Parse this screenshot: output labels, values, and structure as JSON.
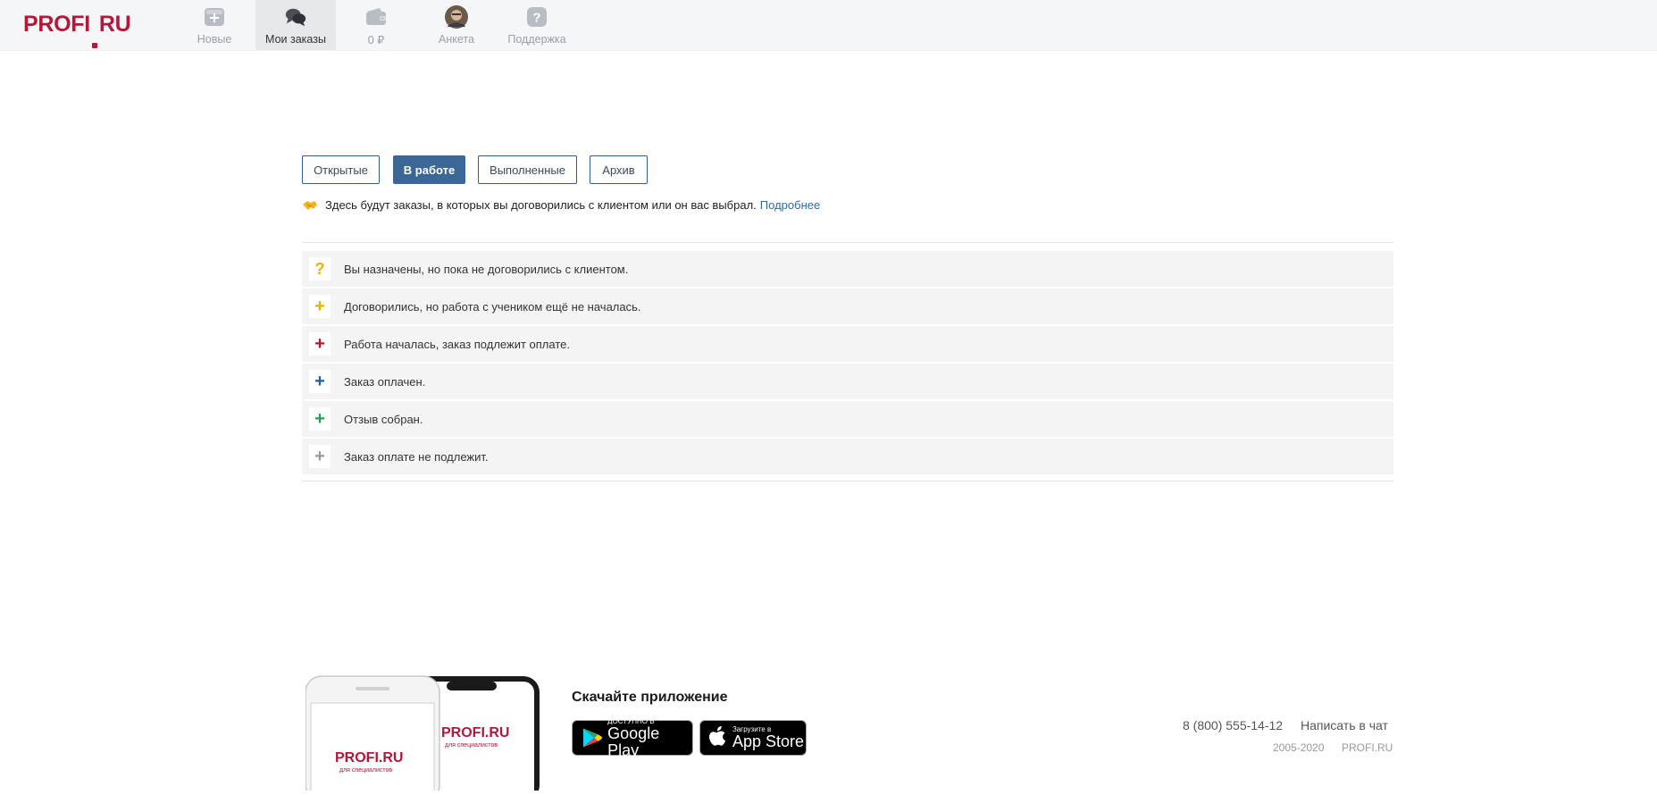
{
  "header": {
    "logo": "PROFI.RU",
    "nav": [
      {
        "label": "Новые",
        "icon": "new-orders-icon"
      },
      {
        "label": "Мои заказы",
        "icon": "chat-bubbles-icon",
        "active": true
      },
      {
        "label": "0 ₽",
        "icon": "wallet-icon"
      },
      {
        "label": "Анкета",
        "icon": "avatar"
      },
      {
        "label": "Поддержка",
        "icon": "question-icon"
      }
    ]
  },
  "tabs": [
    {
      "label": "Открытые"
    },
    {
      "label": "В работе",
      "selected": true
    },
    {
      "label": "Выполненные"
    },
    {
      "label": "Архив"
    }
  ],
  "info": {
    "icon": "handshake-icon",
    "text": "Здесь будут заказы, в которых вы договорились с клиентом или он вас выбрал.",
    "link": "Подробнее"
  },
  "legend": [
    {
      "symbol": "?",
      "color": "#e7b400",
      "text": "Вы назначены, но пока не договорились с клиентом."
    },
    {
      "symbol": "+",
      "color": "#e7b400",
      "text": "Договорились, но работа с учеником ещё не началась."
    },
    {
      "symbol": "+",
      "color": "#c0142b",
      "text": "Работа началась, заказ подлежит оплате."
    },
    {
      "symbol": "+",
      "color": "#1d5fa8",
      "text": "Заказ оплачен."
    },
    {
      "symbol": "+",
      "color": "#1fa352",
      "text": "Отзыв собран."
    },
    {
      "symbol": "+",
      "color": "#9a9a9a",
      "text": "Заказ оплате не подлежит."
    }
  ],
  "footer": {
    "download_title": "Скачайте приложение",
    "phone_logo": "PROFI.RU",
    "phone_subtitle": "для специалистов",
    "google_play": {
      "small": "ДОСТУПНО В",
      "big": "Google Play"
    },
    "app_store": {
      "small": "Загрузите в",
      "big": "App Store"
    },
    "phone": "8 (800) 555-14-12",
    "chat": "Написать в чат",
    "years": "2005-2020",
    "brand": "PROFI.RU"
  },
  "colors": {
    "brand": "#b5173b",
    "accent": "#3a6796",
    "link": "#2f6aa6"
  }
}
